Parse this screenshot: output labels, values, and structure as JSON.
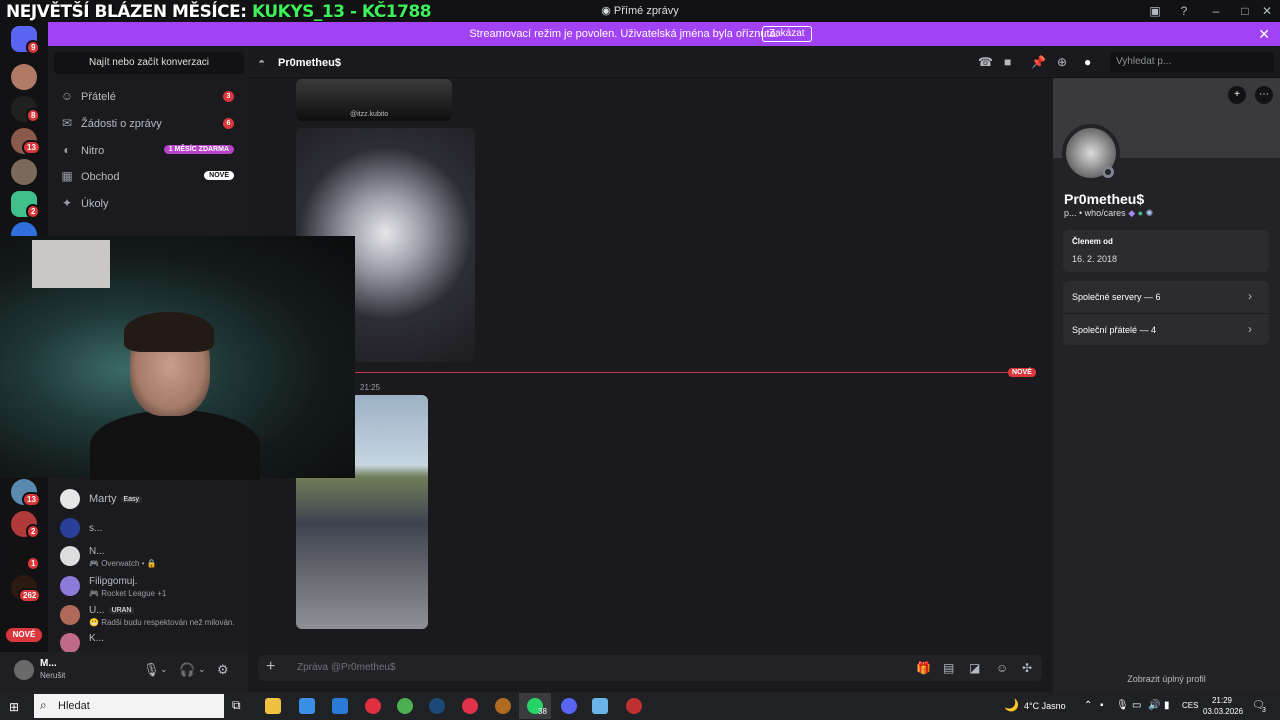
{
  "overlay_title": {
    "white": "NEJVĚTŠÍ BLÁZEN MĚSÍCE:",
    "green": "KUKYS_13 - KČ1788"
  },
  "window": {
    "title": "Přímé zprávy"
  },
  "banner": {
    "text": "Streamovací režim je povolen. Uživatelská jména byla oříznuta.",
    "button": "Zakázat"
  },
  "rail": {
    "badges": [
      "9",
      "8",
      "13",
      "2",
      "13",
      "2",
      "1",
      "262"
    ],
    "new_label": "NOVÉ"
  },
  "sidebar": {
    "search": "Najít nebo začít konverzaci",
    "nav": [
      {
        "label": "Přátelé",
        "badge": "3"
      },
      {
        "label": "Žádosti o zprávy",
        "badge": "6"
      },
      {
        "label": "Nitro",
        "pill": "1 MĚSÍC ZDARMA"
      },
      {
        "label": "Obchod",
        "pill": "NOVÉ"
      },
      {
        "label": "Úkoly"
      }
    ],
    "dms": [
      {
        "name": "Marty",
        "tag": "Easy",
        "status": ""
      },
      {
        "name": "s...",
        "status": ""
      },
      {
        "name": "N...",
        "status": "Overwatch • 🔒"
      },
      {
        "name": "Filipgomuj.",
        "status": "Rocket League +1"
      },
      {
        "name": "U...",
        "tag": "URAN",
        "status": "Radši budu respektován než milován."
      },
      {
        "name": "K...",
        "status": ""
      }
    ]
  },
  "user_panel": {
    "name": "M...",
    "status": "Nerušit"
  },
  "chat": {
    "title": "Pr0metheu$",
    "search_placeholder": "Vyhledat p...",
    "image_caption": "@itzz.kubito",
    "new_divider": "NOVÉ",
    "timestamp": "21:25",
    "composer_placeholder": "Zpráva @Pr0metheu$"
  },
  "profile": {
    "name": "Pr0metheu$",
    "sub": "p... • who/cares",
    "member_label": "Členem od",
    "member_date": "16. 2. 2018",
    "mutual_servers": "Společné servery — 6",
    "mutual_friends": "Společní přátelé — 4",
    "full_profile": "Zobrazit úplný profil"
  },
  "taskbar": {
    "search": "Hledat",
    "whatsapp_badge": "38",
    "weather": "4°C  Jasno",
    "lang": "CES",
    "time": "21:29",
    "date": "03.03.2026",
    "notif": "3"
  },
  "colors": {
    "accent": "#a242f5",
    "danger": "#da373c",
    "nitro": "#b845c9",
    "overlay_green": "#3ef05a"
  }
}
